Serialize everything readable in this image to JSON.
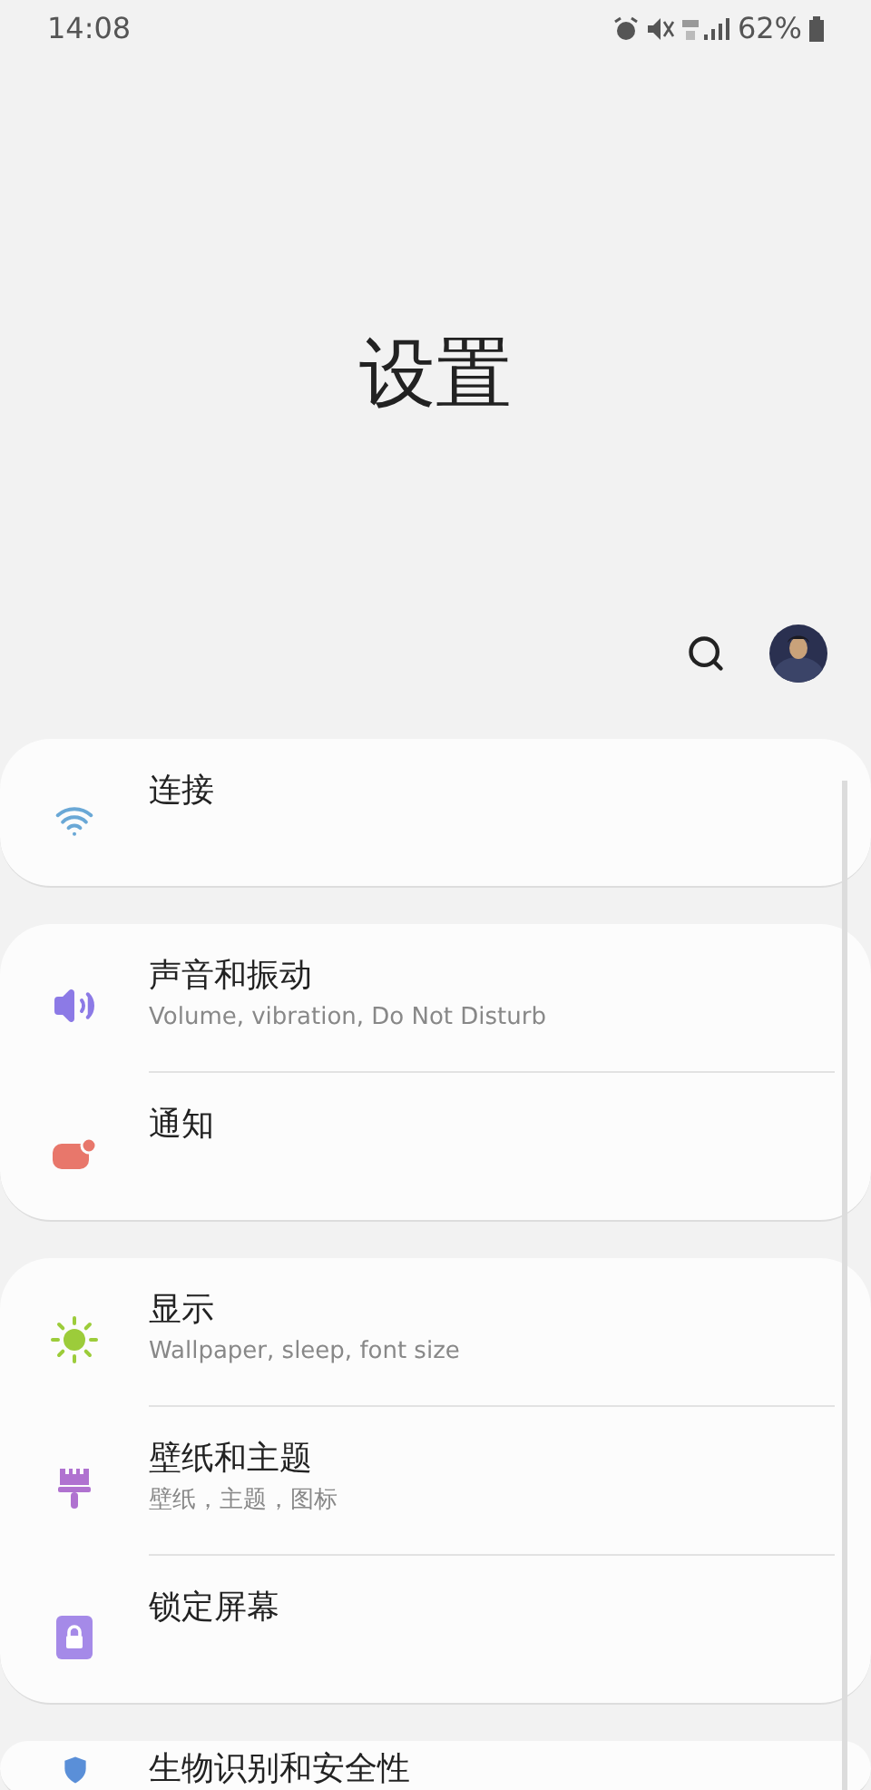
{
  "status_bar": {
    "time": "14:08",
    "battery": "62%"
  },
  "title": "设置",
  "groups": [
    {
      "items": [
        {
          "kind": "wifi",
          "title": "连接"
        }
      ]
    },
    {
      "items": [
        {
          "kind": "sound",
          "title": "声音和振动",
          "subtitle": "Volume, vibration, Do Not Disturb"
        },
        {
          "kind": "notification",
          "title": "通知"
        }
      ]
    },
    {
      "items": [
        {
          "kind": "display",
          "title": "显示",
          "subtitle": "Wallpaper, sleep, font size"
        },
        {
          "kind": "theme",
          "title": "壁纸和主题",
          "subtitle": "壁纸，主题，图标"
        },
        {
          "kind": "lock",
          "title": "锁定屏幕"
        }
      ]
    },
    {
      "items": [
        {
          "kind": "biometrics",
          "title": "生物识别和安全性"
        }
      ]
    }
  ]
}
